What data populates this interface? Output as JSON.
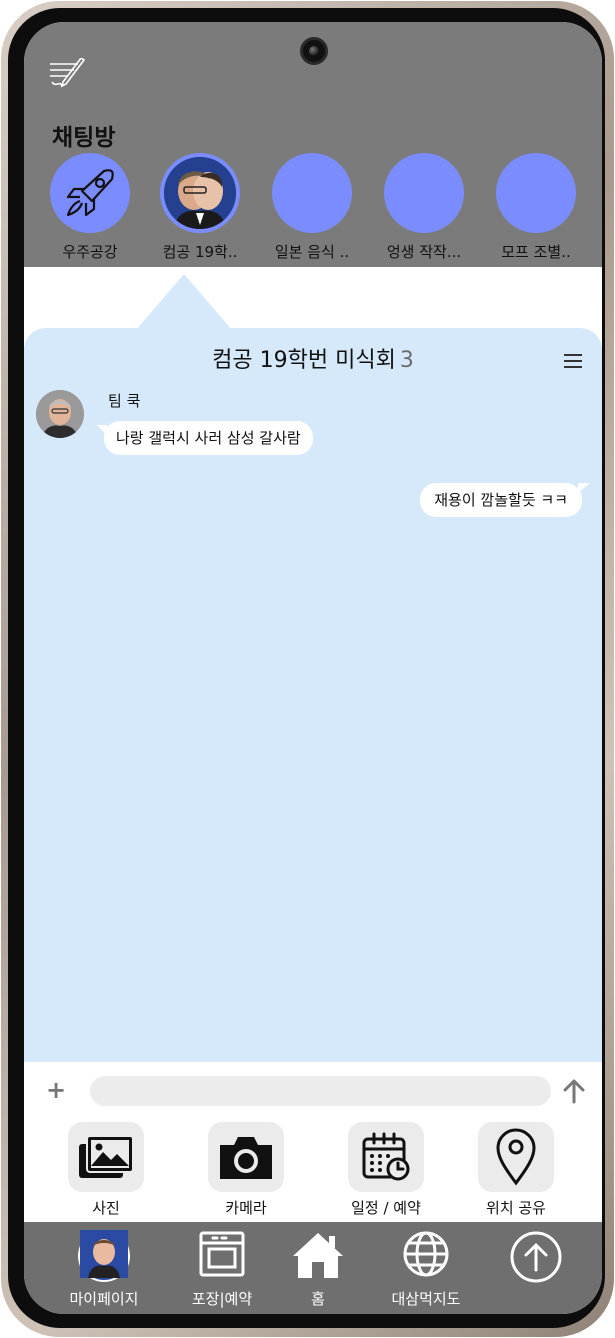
{
  "header": {
    "title": "채팅방",
    "rooms": [
      {
        "label": "우주공강",
        "icon": "rocket-icon"
      },
      {
        "label": "컴공 19학..",
        "icon": "group-photo",
        "selected": true
      },
      {
        "label": "일본 음식 ..",
        "icon": ""
      },
      {
        "label": "엉생 작작...",
        "icon": ""
      },
      {
        "label": "모프 조별..",
        "icon": ""
      }
    ]
  },
  "chat": {
    "title": "컴공 19학번 미식회",
    "member_count": "3",
    "messages": [
      {
        "sender": "팀 쿡",
        "text": "나랑 갤럭시 사러 삼성 갈사람",
        "direction": "in"
      },
      {
        "text": "재용이 깜놀할듯 ㅋㅋ",
        "direction": "out"
      }
    ]
  },
  "input": {
    "placeholder": ""
  },
  "attachments": [
    {
      "label": "사진",
      "icon": "photo-icon"
    },
    {
      "label": "카메라",
      "icon": "camera-icon"
    },
    {
      "label": "일정 / 예약",
      "icon": "calendar-icon"
    },
    {
      "label": "위치 공유",
      "icon": "location-pin-icon"
    }
  ],
  "nav": [
    {
      "label": "마이페이지",
      "icon": "avatar"
    },
    {
      "label": "포장|예약",
      "icon": "oven-icon"
    },
    {
      "label": "홈",
      "icon": "home-icon"
    },
    {
      "label": "대삼먹지도",
      "icon": "globe-icon"
    },
    {
      "label": "",
      "icon": "arrow-up-circle-icon"
    }
  ],
  "colors": {
    "header_bg": "#7b7b7b",
    "chat_bg": "#d6e9fb",
    "room_circle": "#7b8cff",
    "nav_bg": "#6f6f6f"
  }
}
